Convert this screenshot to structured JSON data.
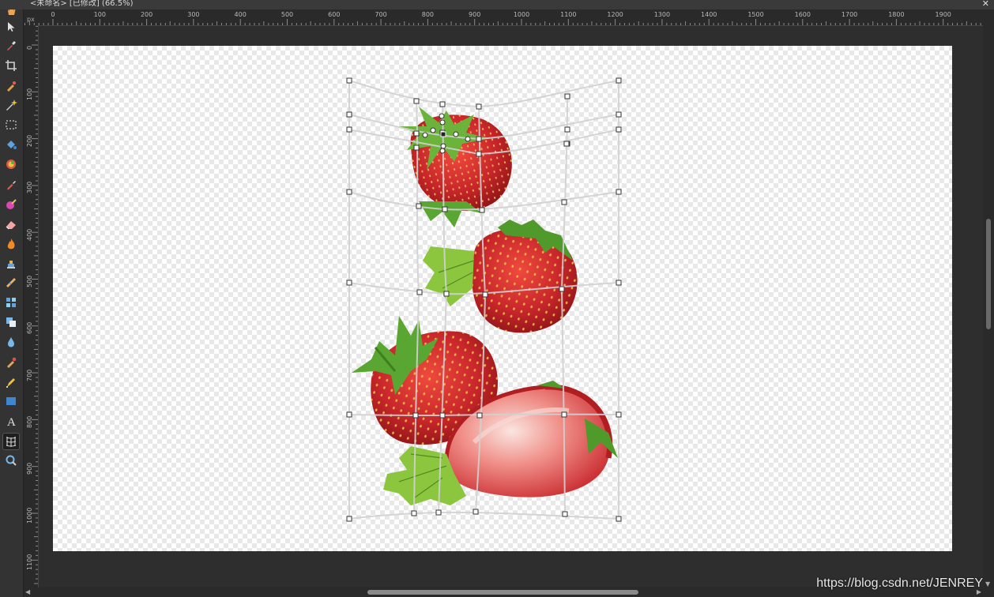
{
  "document": {
    "title": "<未命名> [已修改] (66.5%)",
    "close_glyph": "✕"
  },
  "rulers": {
    "unit": "px",
    "top_labels": [
      "0",
      "100",
      "200",
      "300",
      "400",
      "500",
      "600",
      "700",
      "800",
      "900",
      "1000",
      "1100",
      "1200",
      "1300",
      "1400",
      "1500",
      "1600",
      "1700",
      "1800",
      "1900"
    ],
    "left_labels": [
      "0",
      "100",
      "200",
      "300",
      "400",
      "500",
      "600",
      "700",
      "800",
      "900",
      "1000",
      "1100"
    ]
  },
  "tools": [
    {
      "name": "hand-tool",
      "icon": "hand-icon",
      "active": false
    },
    {
      "name": "move-tool",
      "icon": "arrow-pointer-icon",
      "active": false
    },
    {
      "name": "color-picker-tool",
      "icon": "eyedropper-icon",
      "active": false
    },
    {
      "name": "crop-tool",
      "icon": "crop-icon",
      "active": false
    },
    {
      "name": "selection-brush-tool",
      "icon": "selection-brush-icon",
      "active": false
    },
    {
      "name": "magic-wand-tool",
      "icon": "magic-wand-icon",
      "active": false
    },
    {
      "name": "rectangle-marquee-tool",
      "icon": "marquee-icon",
      "active": false
    },
    {
      "name": "flood-fill-tool",
      "icon": "paint-bucket-icon",
      "active": false
    },
    {
      "name": "gradient-tool",
      "icon": "gradient-icon",
      "active": false
    },
    {
      "name": "paint-brush-tool",
      "icon": "paint-brush-icon",
      "active": false
    },
    {
      "name": "color-replacement-tool",
      "icon": "color-brush-icon",
      "active": false
    },
    {
      "name": "eraser-tool",
      "icon": "eraser-icon",
      "active": false
    },
    {
      "name": "dodge-burn-tool",
      "icon": "flame-icon",
      "active": false
    },
    {
      "name": "clone-stamp-tool",
      "icon": "stamp-icon",
      "active": false
    },
    {
      "name": "healing-brush-tool",
      "icon": "bandage-icon",
      "active": false
    },
    {
      "name": "patch-tool",
      "icon": "patch-icon",
      "active": false
    },
    {
      "name": "clone-tool",
      "icon": "clone-icon",
      "active": false
    },
    {
      "name": "blur-tool",
      "icon": "drop-icon",
      "active": false
    },
    {
      "name": "smudge-tool",
      "icon": "smudge-icon",
      "active": false
    },
    {
      "name": "pen-tool",
      "icon": "pen-icon",
      "active": false
    },
    {
      "name": "shape-tool",
      "icon": "rectangle-icon",
      "active": false
    },
    {
      "name": "text-tool",
      "icon": "text-icon",
      "active": false
    },
    {
      "name": "mesh-warp-tool",
      "icon": "mesh-warp-icon",
      "active": true
    },
    {
      "name": "zoom-tool",
      "icon": "magnifier-icon",
      "active": false
    }
  ],
  "colors": {
    "strawberry_red": "#c8262b",
    "strawberry_dark": "#8e1416",
    "seed_yellow": "#f0c14a",
    "leaf_green": "#4f9a2a",
    "leaf_light": "#8cc63f",
    "flesh_pink": "#f3b3ae",
    "mesh_line": "#d0d0d0"
  },
  "watermark": "https://blog.csdn.net/JENREY"
}
